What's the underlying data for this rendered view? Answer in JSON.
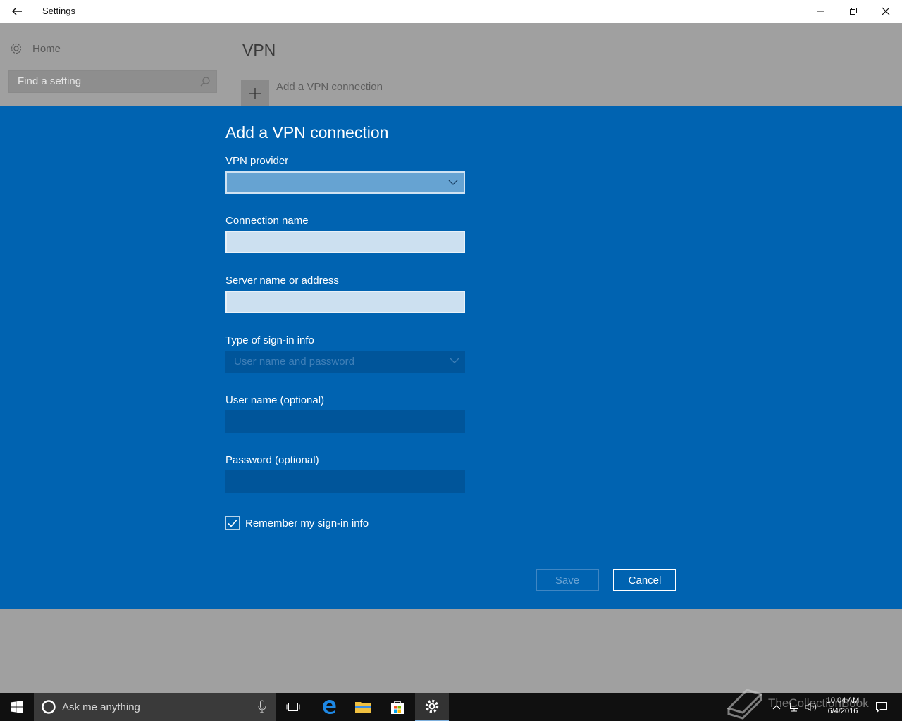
{
  "window": {
    "title": "Settings"
  },
  "sidebar": {
    "home_label": "Home",
    "search_placeholder": "Find a setting"
  },
  "main": {
    "title": "VPN",
    "add_vpn_label": "Add a VPN connection"
  },
  "dialog": {
    "title": "Add a VPN connection",
    "vpn_provider_label": "VPN provider",
    "vpn_provider_value": "",
    "connection_name_label": "Connection name",
    "connection_name_value": "",
    "server_label": "Server name or address",
    "server_value": "",
    "signin_type_label": "Type of sign-in info",
    "signin_type_value": "User name and password",
    "username_label": "User name (optional)",
    "username_value": "",
    "password_label": "Password (optional)",
    "password_value": "",
    "remember_label": "Remember my sign-in info",
    "remember_checked": true,
    "save_label": "Save",
    "cancel_label": "Cancel"
  },
  "taskbar": {
    "search_placeholder": "Ask me anything",
    "time": "10:04 AM",
    "date": "6/4/2016"
  },
  "watermark": {
    "text": "TheCollectionBook"
  },
  "colors": {
    "dialog_bg": "#0063b1",
    "accent": "#0078d7",
    "taskbar_bg": "#101010"
  }
}
